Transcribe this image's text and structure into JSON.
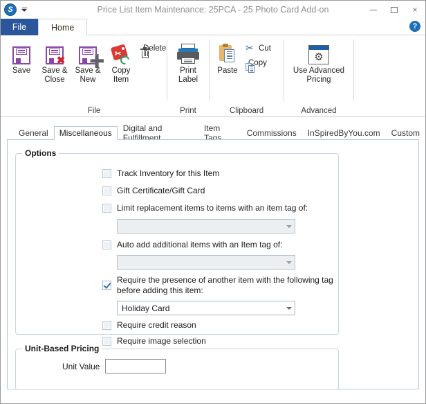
{
  "window": {
    "title": "Price List Item Maintenance: 25PCA - 25 Photo Card Add-on",
    "app_icon_letter": "S",
    "minimize_label": "Minimize",
    "maximize_label": "Maximize",
    "close_label": "×",
    "help_label": "?"
  },
  "ribbon_tabs": {
    "file": "File",
    "home": "Home"
  },
  "ribbon": {
    "groups": [
      {
        "label": "File",
        "buttons": [
          {
            "label": "Save",
            "icon": "save-floppy-icon"
          },
          {
            "label": "Save &\nClose",
            "line1": "Save &",
            "line2": "Close",
            "icon": "save-close-floppy-icon"
          },
          {
            "label": "Save &\nNew",
            "line1": "Save &",
            "line2": "New",
            "icon": "save-new-floppy-icon"
          },
          {
            "label": "Copy\nItem",
            "line1": "Copy",
            "line2": "Item",
            "icon": "copy-item-tag-icon"
          }
        ],
        "small_buttons": [
          {
            "label": "Delete",
            "icon": "trash-icon"
          }
        ]
      },
      {
        "label": "Print",
        "buttons": [
          {
            "line1": "Print",
            "line2": "Label",
            "icon": "printer-icon"
          }
        ]
      },
      {
        "label": "Clipboard",
        "buttons": [
          {
            "line1": "Paste",
            "line2": "",
            "icon": "paste-icon"
          }
        ],
        "small_buttons": [
          {
            "label": "Cut",
            "icon": "scissors-icon"
          },
          {
            "label": "Copy",
            "icon": "copy-icon"
          }
        ]
      },
      {
        "label": "Advanced",
        "buttons": [
          {
            "line1": "Use Advanced",
            "line2": "Pricing",
            "icon": "advanced-pricing-gear-icon"
          }
        ]
      }
    ]
  },
  "page_tabs": [
    {
      "label": "General",
      "active": false
    },
    {
      "label": "Miscellaneous",
      "active": true
    },
    {
      "label": "Digital and Fulfillment",
      "active": false
    },
    {
      "label": "Item Tags",
      "active": false
    },
    {
      "label": "Commissions",
      "active": false
    },
    {
      "label": "InSpiredByYou.com",
      "active": false
    },
    {
      "label": "Custom",
      "active": false
    }
  ],
  "options_group": {
    "title": "Options",
    "checkboxes": {
      "track_inventory": "Track Inventory for this Item",
      "gift_certificate": "Gift Certificate/Gift Card",
      "limit_replacement": "Limit replacement items to items with an item tag of:",
      "auto_add": "Auto add additional items with an Item tag of:",
      "require_presence_line1": "Require the presence of another item with the following tag",
      "require_presence_line2": "before adding this item:",
      "require_credit_reason": "Require credit reason",
      "require_image_selection": "Require image selection"
    },
    "dropdowns": {
      "limit_replacement_value": "",
      "auto_add_value": "",
      "require_presence_value": "Holiday Card"
    }
  },
  "unit_pricing_group": {
    "title": "Unit-Based Pricing",
    "unit_value_label": "Unit Value",
    "unit_value": ""
  }
}
